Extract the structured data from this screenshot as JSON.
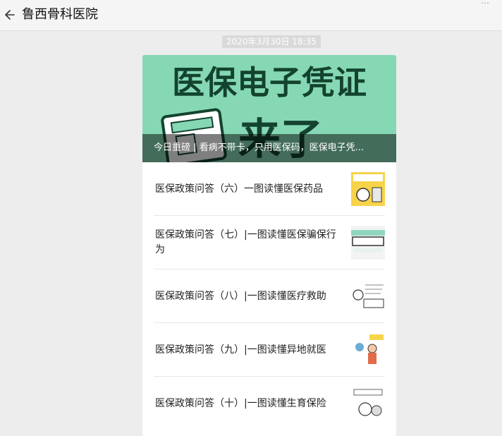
{
  "header": {
    "title": "鲁西骨科医院"
  },
  "timestamp": "2020年3月30日 18:35",
  "banner": {
    "headline": "医保电子凭证",
    "sub": "来了",
    "caption": "今日重磅 | 看病不带卡，只用医保码，医保电子凭..."
  },
  "articles": [
    {
      "title": "医保政策问答（六）一图读懂医保药品",
      "thumb": "thumb-yellow-cartoon"
    },
    {
      "title": "医保政策问答（七）|一图读懂医保骗保行为",
      "thumb": "thumb-green-policy"
    },
    {
      "title": "医保政策问答（八）|一图读懂医疗救助",
      "thumb": "thumb-sketch-doctor"
    },
    {
      "title": "医保政策问答（九）|一图读懂异地就医",
      "thumb": "thumb-cartoon-people"
    },
    {
      "title": "医保政策问答（十）|一图读懂生育保险",
      "thumb": "thumb-sketch-family"
    }
  ],
  "colors": {
    "banner_bg": "#86d8b4",
    "banner_text": "#13432f",
    "divider_green": "#07c160"
  }
}
